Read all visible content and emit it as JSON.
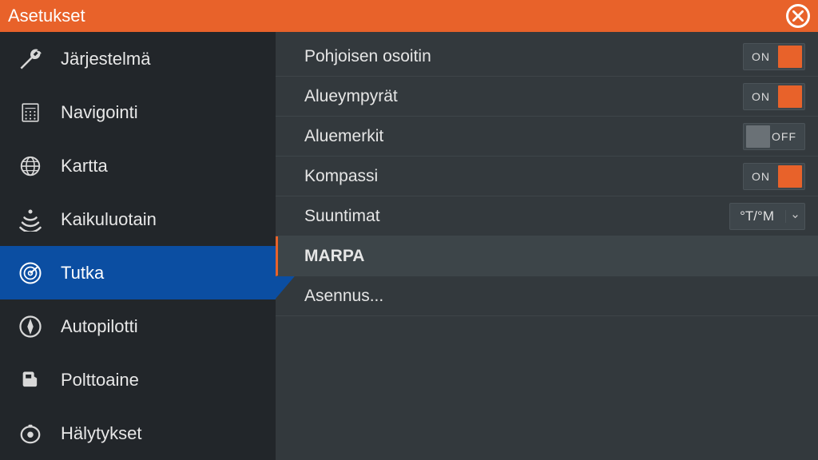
{
  "window": {
    "title": "Asetukset"
  },
  "sidebar": {
    "items": [
      {
        "label": "Järjestelmä"
      },
      {
        "label": "Navigointi"
      },
      {
        "label": "Kartta"
      },
      {
        "label": "Kaikuluotain"
      },
      {
        "label": "Tutka"
      },
      {
        "label": "Autopilotti"
      },
      {
        "label": "Polttoaine"
      },
      {
        "label": "Hälytykset"
      }
    ],
    "active_index": 4
  },
  "main": {
    "rows": [
      {
        "label": "Pohjoisen osoitin",
        "toggle_on": "ON"
      },
      {
        "label": "Alueympyrät",
        "toggle_on": "ON"
      },
      {
        "label": "Aluemerkit",
        "toggle_off": "OFF"
      },
      {
        "label": "Kompassi",
        "toggle_on": "ON"
      },
      {
        "label": "Suuntimat",
        "dropdown_value": "°T/°M"
      },
      {
        "label": "MARPA"
      },
      {
        "label": "Asennus..."
      }
    ]
  }
}
